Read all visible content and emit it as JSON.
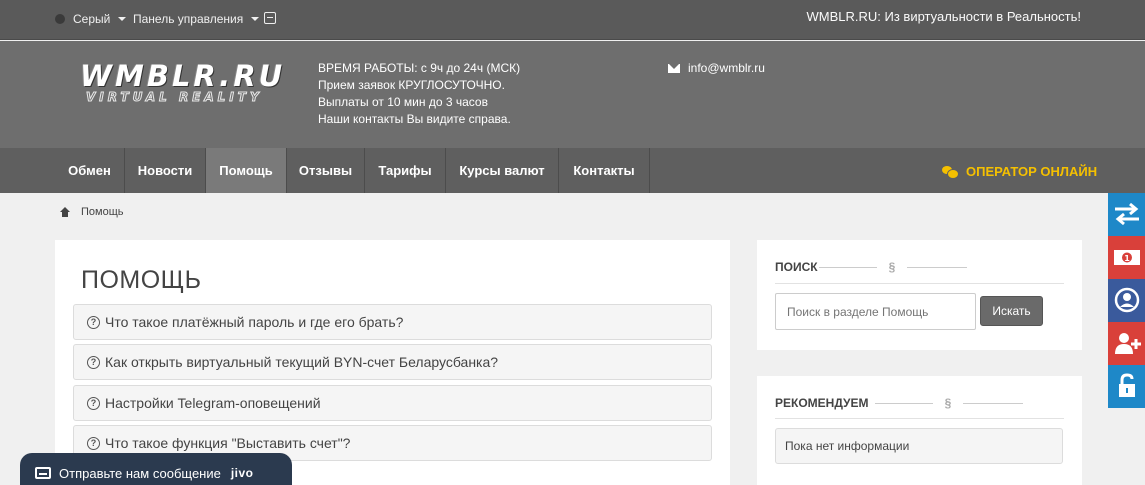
{
  "topbar": {
    "theme_label": "Серый",
    "panel_label": "Панель управления",
    "slogan": "WMBLR.RU: Из виртуальности в Реальность!"
  },
  "header": {
    "logo_main": "WMBLR.RU",
    "logo_sub": "VIRTUAL REALITY",
    "hours_lines": [
      "ВРЕМЯ РАБОТЫ: с 9ч до 24ч (МСК)",
      "Прием заявок КРУГЛОСУТОЧНО.",
      "Выплаты от 10 мин до 3 часов",
      "Наши контакты Вы видите справа."
    ],
    "email": "info@wmblr.ru"
  },
  "nav": {
    "tabs": [
      {
        "label": "Обмен"
      },
      {
        "label": "Новости"
      },
      {
        "label": "Помощь"
      },
      {
        "label": "Отзывы"
      },
      {
        "label": "Тарифы"
      },
      {
        "label": "Курсы валют"
      },
      {
        "label": "Контакты"
      }
    ],
    "operator_label": "ОПЕРАТОР ОНЛАЙН"
  },
  "breadcrumb": {
    "current": "Помощь"
  },
  "main": {
    "title": "ПОМОЩЬ",
    "faq": [
      {
        "question": "Что такое платёжный пароль и где его брать?"
      },
      {
        "question": "Как открыть виртуальный текущий BYN-счет Беларусбанка?"
      },
      {
        "question": "Настройки Telegram-оповещений"
      },
      {
        "question": "Что такое функция \"Выставить счет\"?"
      }
    ]
  },
  "search_widget": {
    "title": "ПОИСК",
    "placeholder": "Поиск в разделе Помощь",
    "button_label": "Искать"
  },
  "recommend_widget": {
    "title": "РЕКОМЕНДУЕМ",
    "empty_text": "Пока нет информации"
  },
  "side_buttons": [
    {
      "icon": "exchange-arrows-icon",
      "color": "#1e88c8"
    },
    {
      "icon": "money-icon",
      "color": "#d9403a"
    },
    {
      "icon": "user-icon",
      "color": "#3a5a9c"
    },
    {
      "icon": "user-add-icon",
      "color": "#d9403a"
    },
    {
      "icon": "unlock-icon",
      "color": "#1e88c8"
    }
  ],
  "jivo": {
    "message": "Отправьте нам сообщение",
    "brand": "jivo"
  },
  "colors": {
    "accent": "#f5c000",
    "topbar": "#5a5a5a",
    "header": "#6e6e6e",
    "nav": "#5f5f5f",
    "nav_active": "#7a7a7a",
    "jivo": "#2b3a4f"
  }
}
